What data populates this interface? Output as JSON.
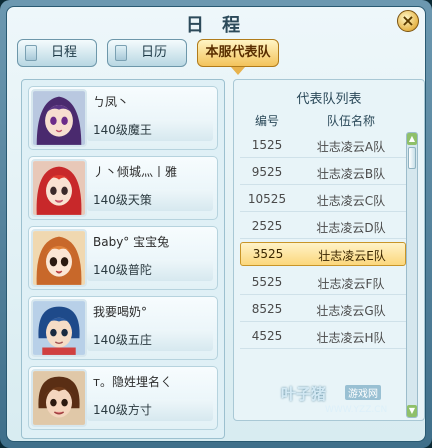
{
  "window": {
    "title": "日 程",
    "close_symbol": "×"
  },
  "tabs": [
    {
      "label": "日程",
      "active": false
    },
    {
      "label": "日历",
      "active": false
    },
    {
      "label": "本服代表队",
      "active": true
    }
  ],
  "members": [
    {
      "name": "ㄅ凤丶",
      "level": "140级魔王",
      "avatar": "girl-purple-hair"
    },
    {
      "name": "丿丶倾城灬丨雅",
      "level": "140级天策",
      "avatar": "girl-red-hair"
    },
    {
      "name": "Baby° 宝宝兔",
      "level": "140级普陀",
      "avatar": "girl-orange-hair"
    },
    {
      "name": "我要喝奶°",
      "level": "140级五庄",
      "avatar": "boy-blue-hair"
    },
    {
      "name": "т。隐姓埋名ㄑ",
      "level": "140级方寸",
      "avatar": "boy-brown-hair"
    }
  ],
  "team_list": {
    "title": "代表队列表",
    "headers": {
      "number": "编号",
      "name": "队伍名称"
    },
    "rows": [
      {
        "number": "1525",
        "name": "壮志凌云A队",
        "selected": false
      },
      {
        "number": "9525",
        "name": "壮志凌云B队",
        "selected": false
      },
      {
        "number": "10525",
        "name": "壮志凌云C队",
        "selected": false
      },
      {
        "number": "2525",
        "name": "壮志凌云D队",
        "selected": false
      },
      {
        "number": "3525",
        "name": "壮志凌云E队",
        "selected": true
      },
      {
        "number": "5525",
        "name": "壮志凌云F队",
        "selected": false
      },
      {
        "number": "8525",
        "name": "壮志凌云G队",
        "selected": false
      },
      {
        "number": "4525",
        "name": "壮志凌云H队",
        "selected": false
      }
    ]
  },
  "watermark": {
    "main": "叶子猪",
    "badge": "游戏网",
    "url": "WWW.YZZ.CN"
  },
  "colors": {
    "active_tab": "#f3c35c",
    "selected_row": "#fbd77c",
    "frame": "#3f6f8a"
  }
}
